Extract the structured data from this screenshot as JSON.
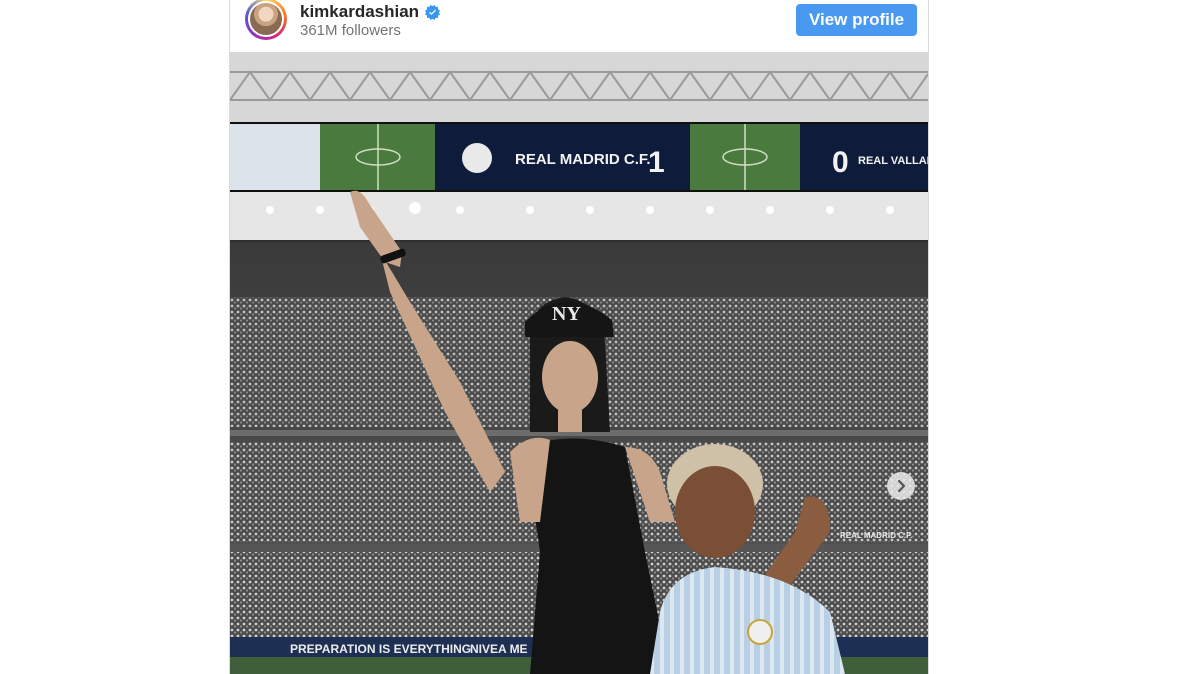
{
  "post": {
    "username": "kimkardashian",
    "followers": "361M followers",
    "view_profile_label": "View profile",
    "verified_icon": "verified-badge-icon",
    "verified_color": "#3897f0",
    "button_color": "#4a99f0"
  },
  "photo": {
    "scoreboard_home": "REAL MADRID C.F.",
    "score_home": "1",
    "score_away": "0",
    "scoreboard_away": "REAL VALLAD",
    "banner_1": "PREPARATION IS EVERYTHING",
    "banner_2": "NIVEA ME",
    "banner_right": "REAL MADRID C.F.",
    "cap_logo": "NY"
  }
}
